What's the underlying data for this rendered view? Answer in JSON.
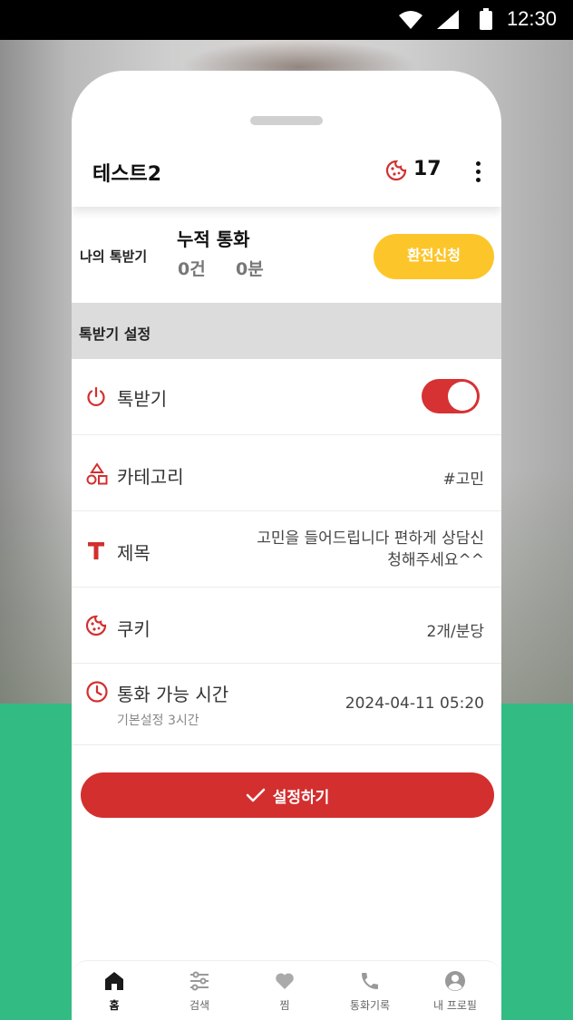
{
  "status_bar": {
    "time": "12:30",
    "icons": [
      "wifi-icon",
      "signal-icon",
      "battery-icon"
    ]
  },
  "header": {
    "title": "테스트2",
    "cookie_count": "17",
    "cookie_icon": "cookie-icon",
    "menu_icon": "more-vert-icon"
  },
  "summary": {
    "my_label": "나의 톡받기",
    "accumulated_label": "누적 통화",
    "count": "0건",
    "minutes": "0분",
    "exchange_button": "환전신청"
  },
  "settings": {
    "section_title": "톡받기 설정",
    "rows": [
      {
        "icon": "power-icon",
        "label": "톡받기",
        "toggle_on": true
      },
      {
        "icon": "category-shapes-icon",
        "label": "카테고리",
        "value": "#고민"
      },
      {
        "icon": "title-t-icon",
        "label": "제목",
        "value_line1": "고민을 들어드립니다 편하게 상담신",
        "value_line2": "청해주세요^^"
      },
      {
        "icon": "cookie-icon",
        "label": "쿠키",
        "value": "2개/분당"
      },
      {
        "icon": "clock-icon",
        "label": "통화 가능 시간",
        "sublabel": "기본설정 3시간",
        "value": "2024-04-11 05:20"
      }
    ],
    "submit_button": "설정하기"
  },
  "bottom_nav": [
    {
      "icon": "home-icon",
      "label": "홈",
      "active": true
    },
    {
      "icon": "sliders-icon",
      "label": "검색",
      "active": false
    },
    {
      "icon": "heart-icon",
      "label": "찜",
      "active": false
    },
    {
      "icon": "phone-icon",
      "label": "통화기록",
      "active": false
    },
    {
      "icon": "account-circle-icon",
      "label": "내 프로필",
      "active": false
    }
  ],
  "colors": {
    "accent_red": "#d32f2f",
    "accent_yellow": "#fcc52a",
    "background_green": "#33bb84"
  }
}
